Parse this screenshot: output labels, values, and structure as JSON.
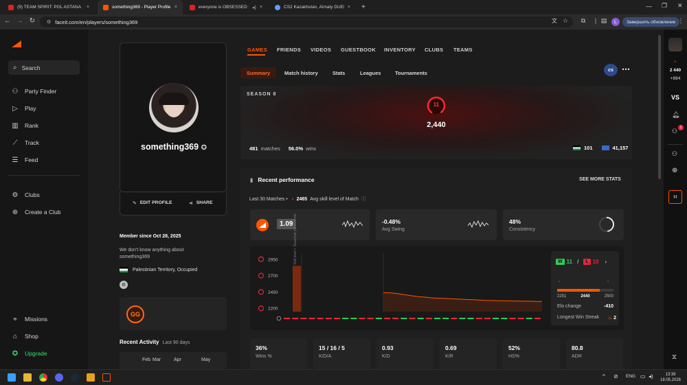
{
  "browser": {
    "tabs": [
      {
        "title": "(9) TEAM SPIRIT: PGL ASTANA",
        "color": "#e02020"
      },
      {
        "title": "something369 - Player Profile -",
        "color": "#ff5500"
      },
      {
        "title": "everyone is OBSESSED with",
        "color": "#e02020"
      },
      {
        "title": "CS2 Kazakhstan, Almaty DUELS",
        "color": "#5aa0ff"
      }
    ],
    "url": "faceit.com/en/players/something369",
    "update_label": "Завершить обновление",
    "avatar_letter": "L"
  },
  "sidebar": {
    "search": "Search",
    "items": [
      "Party Finder",
      "Play",
      "Rank",
      "Track",
      "Feed"
    ],
    "items2": [
      "Clubs",
      "Create a Club"
    ],
    "items3": [
      "Missions",
      "Shop",
      "Upgrade"
    ]
  },
  "profile": {
    "username": "something369",
    "edit": "EDIT PROFILE",
    "share": "SHARE",
    "member_since": "Member since Oct 28, 2025",
    "about": "We don't know anything about something369",
    "country": "Palestinian Territory, Occupied",
    "badge_text": "GG",
    "recent_activity": "Recent Activity",
    "recent_range": "Last 90 days",
    "months": [
      "Feb",
      "Mar",
      "Apr",
      "May"
    ]
  },
  "nav": {
    "tabs": [
      "GAMES",
      "FRIENDS",
      "VIDEOS",
      "GUESTBOOK",
      "INVENTORY",
      "CLUBS",
      "TEAMS"
    ],
    "subtabs": [
      "Summary",
      "Match history",
      "Stats",
      "Leagues",
      "Tournaments"
    ],
    "game_badge": "cs"
  },
  "season": {
    "title": "SEASON 8",
    "level": "11",
    "elo": "2,440",
    "matches": "481",
    "matches_label": "matches",
    "wins_pct": "56.0%",
    "wins_label": "wins",
    "country_rank": "101",
    "region_rank": "41,157"
  },
  "performance": {
    "title": "Recent performance",
    "more": "SEE MORE STATS",
    "last_matches": "Last 30 Matches •",
    "avg_level": "2465",
    "avg_level_label": "Avg skill level of Match",
    "kpis": [
      {
        "value": "1.09",
        "label": ""
      },
      {
        "value": "-0.48%",
        "label": "Avg Swing"
      },
      {
        "value": "48%",
        "label": "Consistency"
      }
    ],
    "chart_note": "Skill level + Seasonal placements",
    "wins": "11",
    "losses": "10",
    "elo_min": "2251",
    "elo_current": "2440",
    "elo_max": "2500",
    "elo_change_label": "Elo change",
    "elo_change": "-410",
    "streak_label": "Longest Win Streak",
    "streak": "2",
    "stats": [
      {
        "value": "36%",
        "label": "Wins %"
      },
      {
        "value": "15 / 16 / 5",
        "label": "K/D/A"
      },
      {
        "value": "0.93",
        "label": "K/D"
      },
      {
        "value": "0.69",
        "label": "K/R"
      },
      {
        "value": "52%",
        "label": "HS%"
      },
      {
        "value": "80.8",
        "label": "ADR"
      }
    ]
  },
  "chart_data": {
    "type": "line",
    "ylim": [
      2150,
      3000
    ],
    "yticks": [
      "2950",
      "2700",
      "2450",
      "2200"
    ],
    "series": [
      {
        "values": [
          2440,
          2435,
          2425,
          2410,
          2395,
          2380,
          2370,
          2360,
          2355,
          2350,
          2345,
          2340,
          2335,
          2330,
          2325,
          2320,
          2318,
          2316,
          2314,
          2312,
          2310,
          2308,
          2306,
          2304
        ]
      }
    ],
    "results": [
      "L",
      "L",
      "L",
      "L",
      "L",
      "L",
      "L",
      "W",
      "W",
      "L",
      "L",
      "W",
      "L",
      "L",
      "W",
      "L",
      "W",
      "L",
      "W",
      "W",
      "L",
      "W",
      "W",
      "L",
      "L",
      "W",
      "W",
      "L",
      "L",
      "W",
      "L"
    ]
  },
  "rail": {
    "elo": "2 440",
    "delta": "+884",
    "vs": "VS",
    "notif_count": "1"
  },
  "taskbar": {
    "lang": "ENG",
    "time": "13:39",
    "date": "18.05.2026"
  }
}
